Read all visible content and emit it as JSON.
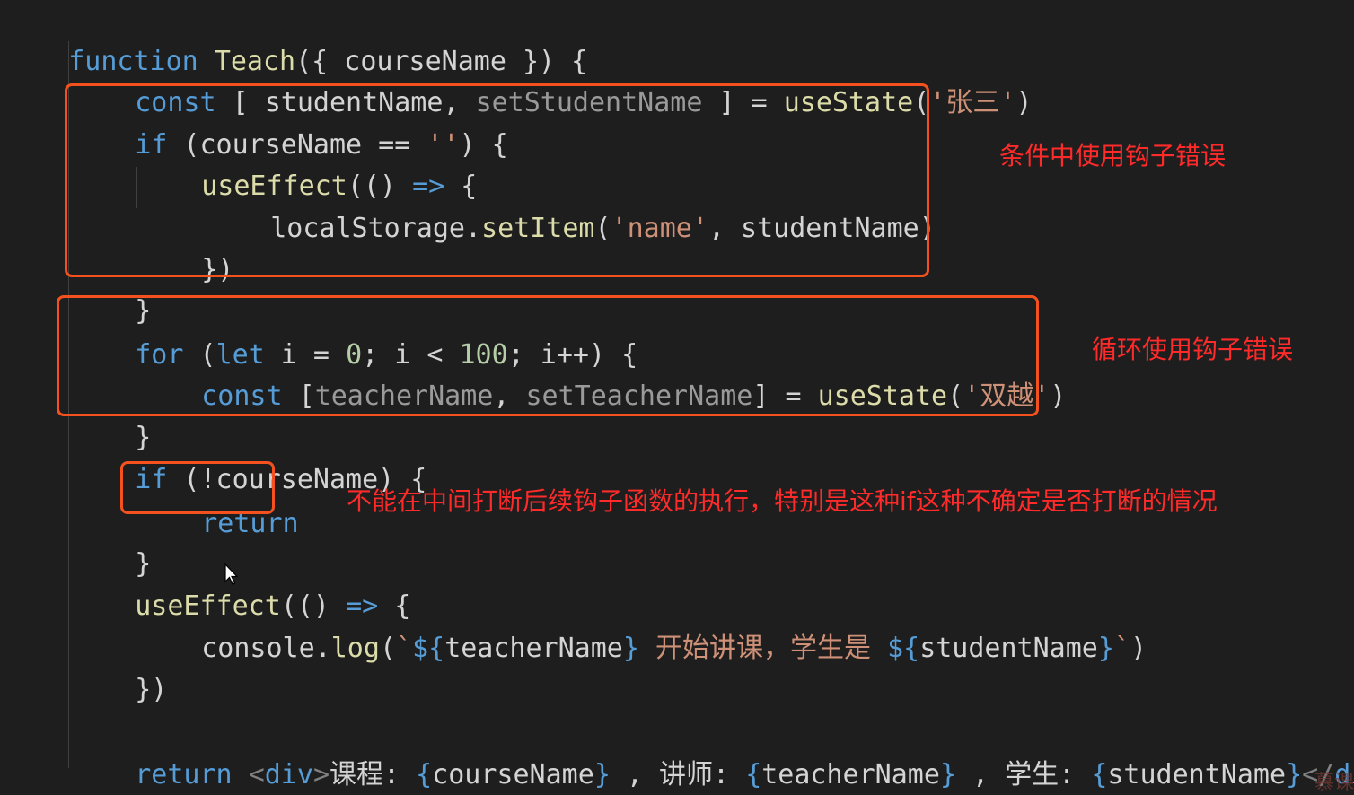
{
  "code": {
    "l1": {
      "kw": "function",
      "name": "Teach",
      "rest": "({ courseName }) {"
    },
    "l2": {
      "kw": "const",
      "open": " [ ",
      "a": "studentName",
      "comma": ", ",
      "b": "setStudentName",
      "mid": " ] = ",
      "fn": "useState",
      "p1": "(",
      "str": "'张三'",
      "p2": ")"
    },
    "l3": {
      "kw": "if",
      "rest": " (courseName == ",
      "str": "''",
      "end": ") {"
    },
    "l4": {
      "fn": "useEffect",
      "a": "(() ",
      "arrow": "=>",
      "b": " {"
    },
    "l5": {
      "a": "localStorage.",
      "fn": "setItem",
      "p1": "(",
      "str": "'name'",
      "b": ", studentName)"
    },
    "l6": {
      "text": "})"
    },
    "l7": {
      "text": "}"
    },
    "l8": {
      "kw": "for",
      "a": " (",
      "kw2": "let",
      "b": " i = ",
      "n1": "0",
      "c": "; i < ",
      "n2": "100",
      "d": "; i++) {"
    },
    "l9": {
      "kw": "const",
      "a": " [",
      "v1": "teacherName",
      "comma": ", ",
      "v2": "setTeacherName",
      "b": "] = ",
      "fn": "useState",
      "p1": "(",
      "str": "'双越'",
      "p2": ")"
    },
    "l10": {
      "text": "}"
    },
    "l11": {
      "kw": "if",
      "rest": " (!courseName) {"
    },
    "l12": {
      "kw": "return"
    },
    "l13": {
      "text": "}"
    },
    "l14": {
      "fn": "useEffect",
      "a": "(() ",
      "arrow": "=>",
      "b": " {"
    },
    "l15": {
      "a": "console.",
      "fn": "log",
      "p1": "(",
      "bt1": "`",
      "t1": "${",
      "v1": "teacherName",
      "t2": "}",
      "mid": " 开始讲课，学生是 ",
      "t3": "${",
      "v2": "studentName",
      "t4": "}",
      "bt2": "`",
      "p2": ")"
    },
    "l16": {
      "text": "})"
    },
    "l18": {
      "kw": "return",
      "sp": " ",
      "lt": "<",
      "tag": "div",
      "gt": ">",
      "a": "课程: ",
      "o1": "{",
      "v1": "courseName",
      "c1": "}",
      "b": " , 讲师: ",
      "o2": "{",
      "v2": "teacherName",
      "c2": "}",
      "c": " , 学生: ",
      "o3": "{",
      "v3": "studentName",
      "c3": "}",
      "close": "</",
      "ctag": "div",
      "cgt": ">"
    },
    "l19": {
      "text": "}"
    }
  },
  "annotations": {
    "condition": "条件中使用钩子错误",
    "loop": "循环使用钩子错误",
    "return": "不能在中间打断后续钩子函数的执行，特别是这种if这种不确定是否打断的情况"
  },
  "watermark": "慕课",
  "colors": {
    "box_border": "#f4511e",
    "note_text": "#ff2a2a",
    "keyword": "#569cd6",
    "function": "#dcdcaa",
    "string": "#ce9178",
    "number": "#b5cea8"
  }
}
